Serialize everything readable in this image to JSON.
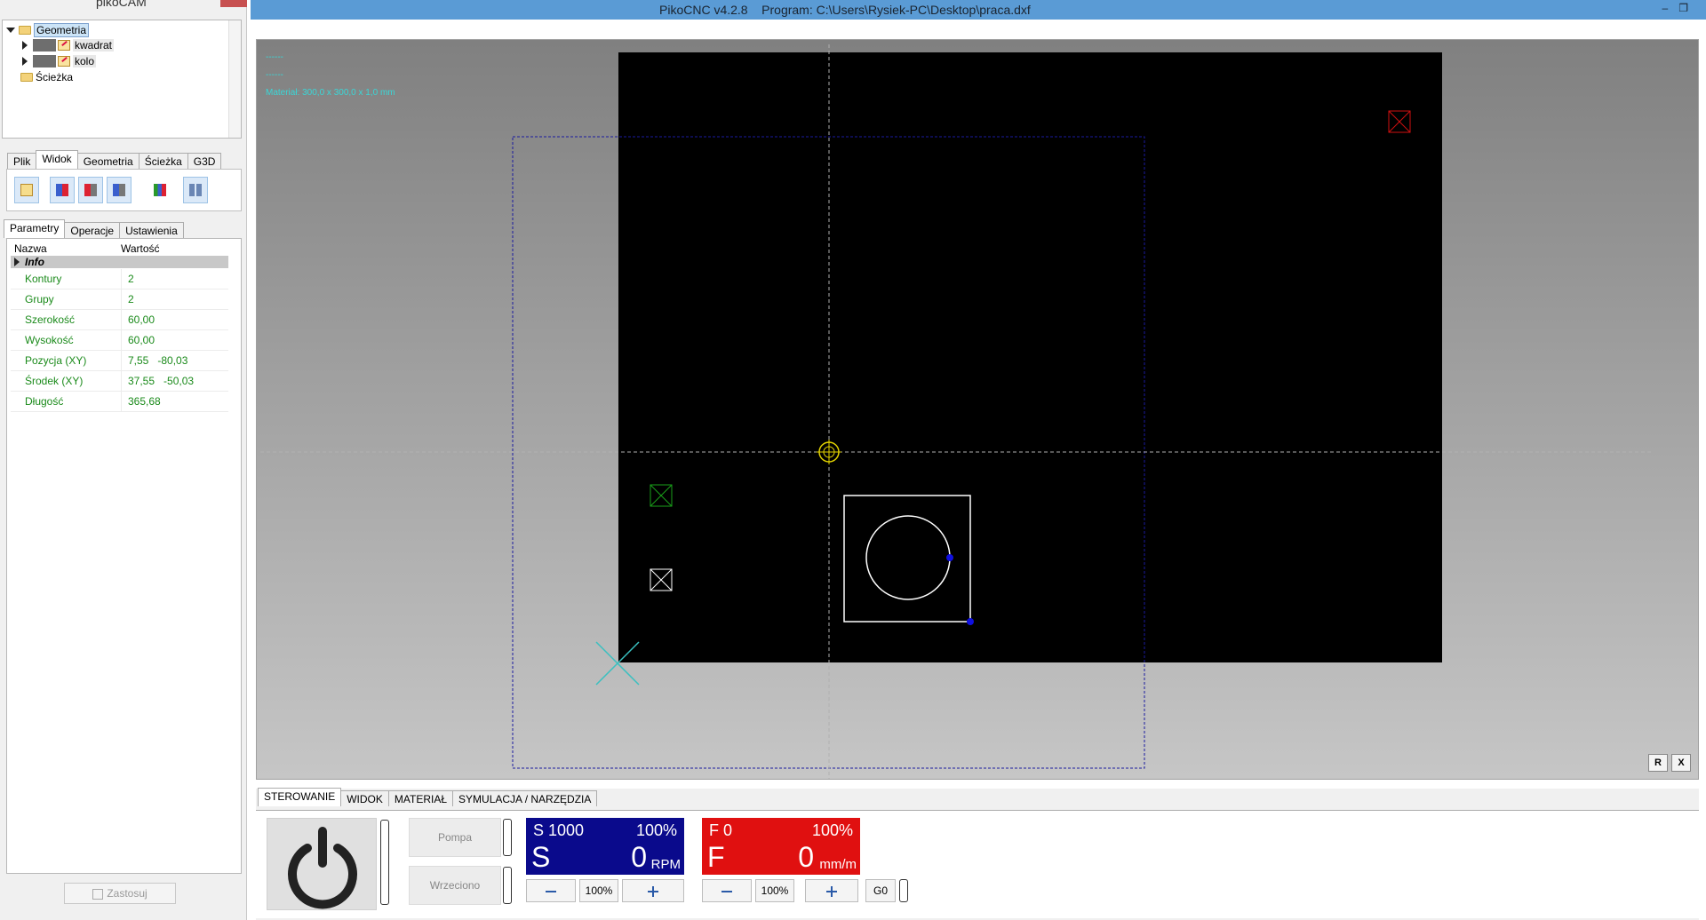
{
  "left_panel": {
    "title": "pikoCAM",
    "tree": {
      "root": "Geometria",
      "items": [
        "kwadrat",
        "kolo"
      ],
      "path_node": "Ścieżka"
    },
    "toolbar_tabs": [
      "Plik",
      "Widok",
      "Geometria",
      "Ścieżka",
      "G3D"
    ],
    "active_toolbar_tab": "Widok",
    "param_tabs": [
      "Parametry",
      "Operacje",
      "Ustawienia"
    ],
    "active_param_tab": "Parametry",
    "columns": {
      "name": "Nazwa",
      "value": "Wartość"
    },
    "group": "Info",
    "rows": [
      {
        "name": "Kontury",
        "value": "2"
      },
      {
        "name": "Grupy",
        "value": "2"
      },
      {
        "name": "Szerokość",
        "value": "60,00"
      },
      {
        "name": "Wysokość",
        "value": "60,00"
      },
      {
        "name": "Pozycja (XY)",
        "value": "7,55   -80,03"
      },
      {
        "name": "Środek (XY)",
        "value": "37,55   -50,03"
      },
      {
        "name": "Długość",
        "value": "365,68"
      }
    ],
    "apply_label": "Zastosuj"
  },
  "main_window": {
    "title": "PikoCNC v4.2.8    Program: C:\\Users\\Rysiek-PC\\Desktop\\praca.dxf"
  },
  "viewport": {
    "hud_line1": "------",
    "hud_line2": "------",
    "material": "Materiał: 300,0 x 300,0 x 1,0 mm",
    "btn_r": "R",
    "btn_x": "X"
  },
  "bottom_tabs": [
    "STEROWANIE",
    "WIDOK",
    "MATERIAŁ",
    "SYMULACJA / NARZĘDZIA"
  ],
  "active_bottom_tab": "STEROWANIE",
  "controls": {
    "pump_label": "Pompa",
    "spindle_label": "Wrzeciono",
    "spindle_display": {
      "setpoint": "S 1000",
      "override": "100%",
      "letter": "S",
      "value": "0",
      "unit": "RPM"
    },
    "feed_display": {
      "setpoint": "F 0",
      "override": "100%",
      "letter": "F",
      "value": "0",
      "unit": "mm/m"
    },
    "spindle_pct_label": "100%",
    "feed_pct_label": "100%",
    "g0_label": "G0"
  },
  "colors": {
    "spindle_display_bg": "#0a0a8c",
    "feed_display_bg": "#e01010",
    "titlebar": "#5a9bd5",
    "param_text": "#1a8a1a",
    "hud_text": "#3ad7d7"
  }
}
